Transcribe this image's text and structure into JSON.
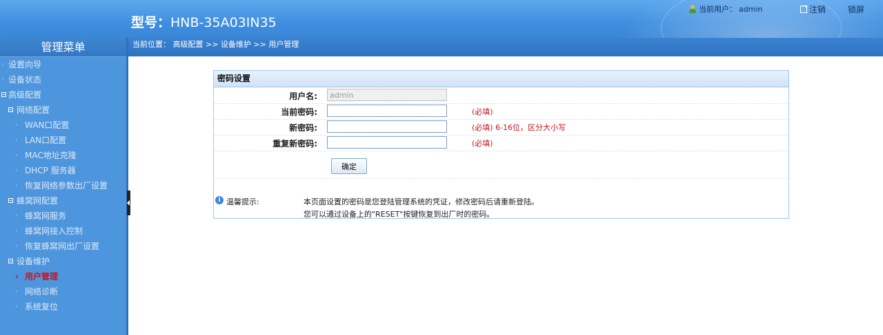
{
  "header": {
    "model_label": "型号：",
    "model_value": "HNB-35A03IN35",
    "current_user_label": "当前用户：",
    "current_user": "admin",
    "logout_label": "注销",
    "lock_label": "锁屏"
  },
  "sidebar": {
    "title": "管理菜单",
    "items": [
      {
        "label": "设置向导",
        "level": 0,
        "marker": "bullet"
      },
      {
        "label": "设备状态",
        "level": 0,
        "marker": "bullet"
      },
      {
        "label": "高级配置",
        "level": 0,
        "marker": "box"
      },
      {
        "label": "网络配置",
        "level": 1,
        "marker": "box"
      },
      {
        "label": "WAN口配置",
        "level": 2,
        "marker": "bullet"
      },
      {
        "label": "LAN口配置",
        "level": 2,
        "marker": "bullet"
      },
      {
        "label": "MAC地址克隆",
        "level": 2,
        "marker": "bullet"
      },
      {
        "label": "DHCP 服务器",
        "level": 2,
        "marker": "bullet"
      },
      {
        "label": "恢复网络参数出厂设置",
        "level": 2,
        "marker": "bullet"
      },
      {
        "label": "蜂窝网配置",
        "level": 1,
        "marker": "box"
      },
      {
        "label": "蜂窝网服务",
        "level": 2,
        "marker": "bullet"
      },
      {
        "label": "蜂窝网接入控制",
        "level": 2,
        "marker": "bullet"
      },
      {
        "label": "恢复蜂窝网出厂设置",
        "level": 2,
        "marker": "bullet"
      },
      {
        "label": "设备维护",
        "level": 1,
        "marker": "box"
      },
      {
        "label": "用户管理",
        "level": 2,
        "marker": "bullet",
        "active": true
      },
      {
        "label": "网络诊断",
        "level": 2,
        "marker": "bullet"
      },
      {
        "label": "系统复位",
        "level": 2,
        "marker": "bullet"
      }
    ]
  },
  "breadcrumb": {
    "text": "当前位置： 高级配置 >> 设备维护 >> 用户管理"
  },
  "form": {
    "title": "密码设置",
    "username_label": "用户名:",
    "username_value": "admin",
    "current_password_label": "当前密码:",
    "current_password_hint": "(必填)",
    "new_password_label": "新密码:",
    "new_password_hint": "(必填) 6-16位，区分大小写",
    "repeat_password_label": "重复新密码:",
    "repeat_password_hint": "(必填)",
    "submit_label": "确定"
  },
  "tip": {
    "label": "温馨提示:",
    "line1": "本页面设置的密码是您登陆管理系统的凭证，修改密码后请重新登陆。",
    "line2": "您可以通过设备上的\"RESET\"按键恢复到出厂时的密码。"
  },
  "colors": {
    "accent": "#3f8fe0",
    "sidebar": "#4d95dd",
    "required": "#c8141e"
  }
}
